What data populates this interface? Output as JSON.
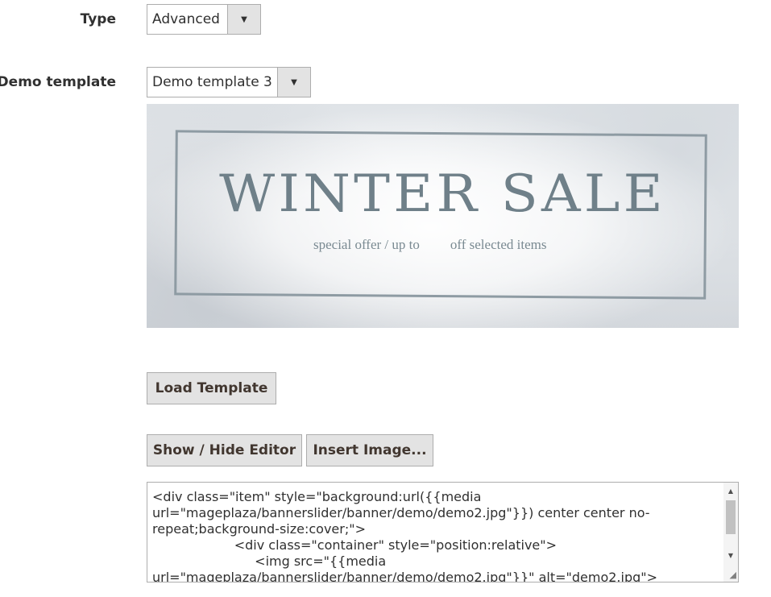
{
  "fields": {
    "type": {
      "label": "Type",
      "value": "Advanced"
    },
    "demo_template": {
      "label": "Demo template",
      "value": "Demo template 3"
    }
  },
  "banner": {
    "title": "WINTER SALE",
    "subtitle_left": "special offer / up to",
    "subtitle_right": "off selected items"
  },
  "buttons": {
    "load_template": "Load Template",
    "show_hide_editor": "Show / Hide Editor",
    "insert_image": "Insert Image..."
  },
  "editor": {
    "content": "<div class=\"item\" style=\"background:url({{media url=\"mageplaza/bannerslider/banner/demo/demo2.jpg\"}}) center center no-repeat;background-size:cover;\">\n                    <div class=\"container\" style=\"position:relative\">\n                         <img src=\"{{media url=\"mageplaza/bannerslider/banner/demo/demo2.jpg\"}}\" alt=\"demo2.jpg\">"
  },
  "icons": {
    "dropdown_arrow": "triangle-down",
    "scroll_up": "triangle-up",
    "scroll_down": "triangle-down",
    "resize_grip": "resize-handle"
  }
}
